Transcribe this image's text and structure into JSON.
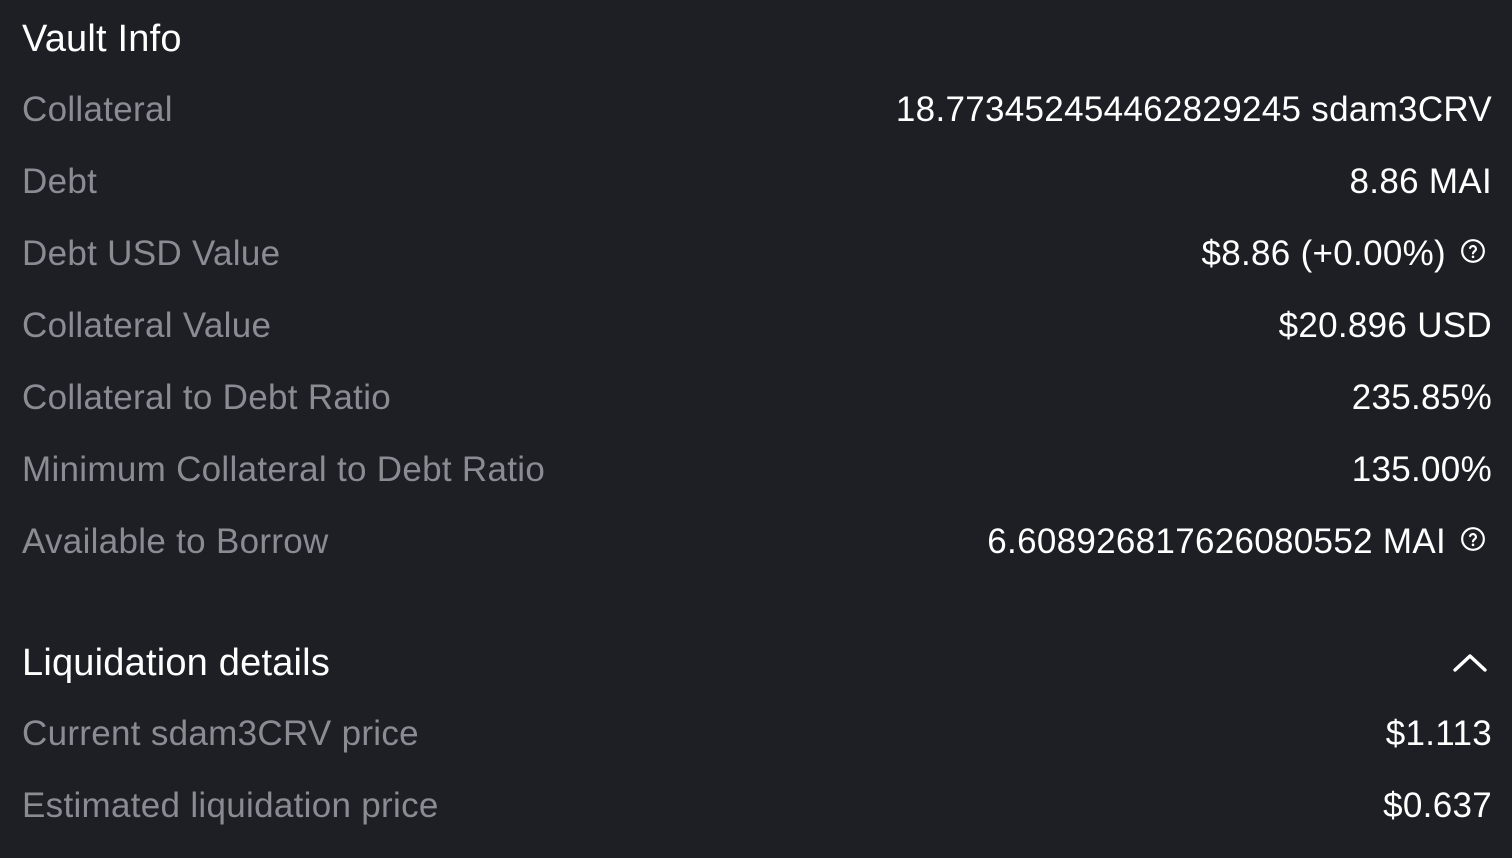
{
  "vault_info": {
    "title": "Vault Info",
    "rows": [
      {
        "label": "Collateral",
        "value": "18.773452454462829245 sdam3CRV"
      },
      {
        "label": "Debt",
        "value": "8.86 MAI"
      },
      {
        "label": "Debt USD Value",
        "value": "$8.86 (+0.00%)",
        "icon": "help-circle-icon"
      },
      {
        "label": "Collateral Value",
        "value": "$20.896",
        "unit": "USD"
      },
      {
        "label": "Collateral to Debt Ratio",
        "value": "235.85%"
      },
      {
        "label": "Minimum Collateral to Debt Ratio",
        "value": "135.00%"
      },
      {
        "label": "Available to Borrow",
        "value": "6.608926817626080552 MAI",
        "icon": "help-circle-icon"
      }
    ]
  },
  "liquidation": {
    "title": "Liquidation details",
    "toggle_icon": "chevron-up-icon",
    "rows": [
      {
        "label": "Current sdam3CRV price",
        "value": "$1.113"
      },
      {
        "label": "Estimated liquidation price",
        "value": "$0.637"
      }
    ]
  },
  "colors": {
    "background": "#1e1f25",
    "label": "#8a8c94",
    "value": "#ffffff"
  }
}
